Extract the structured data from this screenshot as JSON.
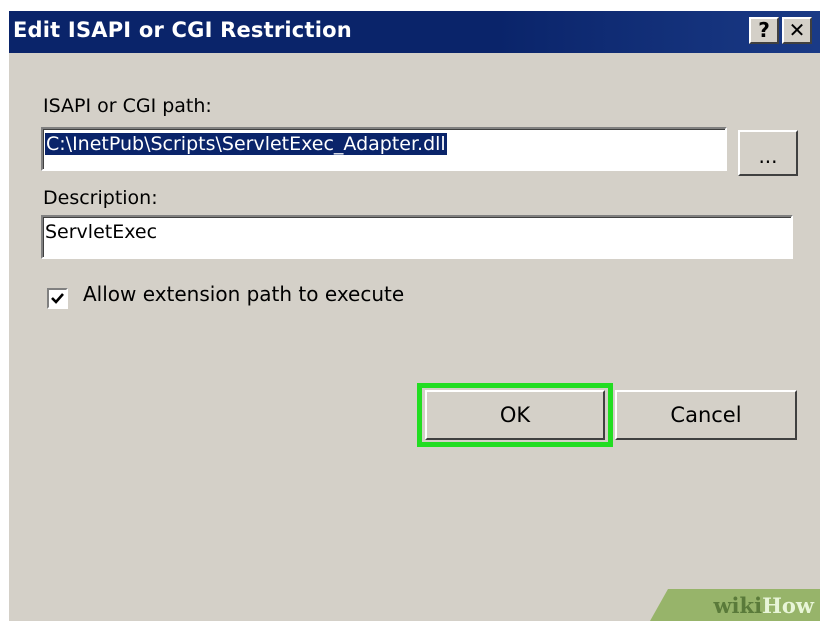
{
  "window": {
    "title": "Edit ISAPI or CGI Restriction",
    "help_glyph": "?",
    "close_glyph": "✕"
  },
  "form": {
    "path_label": "ISAPI or CGI path:",
    "path_value": "C:\\InetPub\\Scripts\\ServletExec_Adapter.dll",
    "browse_label": "...",
    "description_label": "Description:",
    "description_value": "ServletExec",
    "allow_label": "Allow extension path to execute",
    "allow_checked": true
  },
  "buttons": {
    "ok_label": "OK",
    "cancel_label": "Cancel"
  },
  "watermark": {
    "wiki": "wiki",
    "how": "How"
  },
  "colors": {
    "titlebar": "#0a246a",
    "dialog_bg": "#d4d0c8",
    "highlight": "#22dd22",
    "selection": "#0a246a"
  },
  "icons": {
    "help": "help-icon",
    "close": "close-icon",
    "checkbox": "checkmark-icon"
  }
}
